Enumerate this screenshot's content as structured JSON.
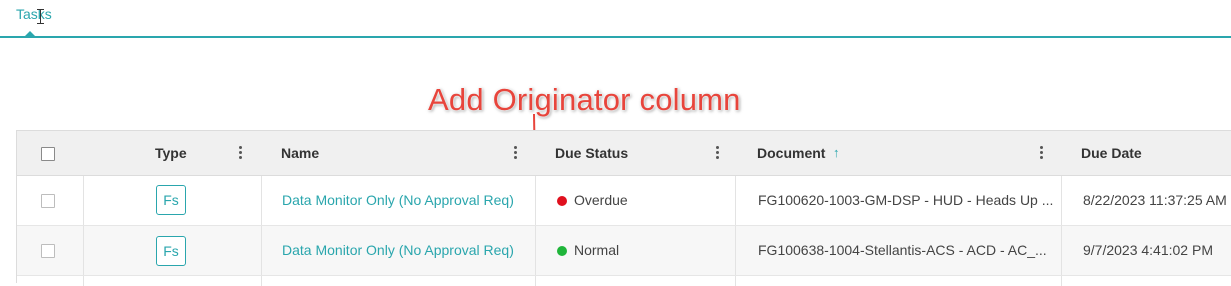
{
  "tabs": [
    {
      "label": "Tasks"
    }
  ],
  "annotation": {
    "text": "Add Originator column",
    "color": "#e8453c"
  },
  "grid": {
    "columns": [
      {
        "label": "Type"
      },
      {
        "label": "Name"
      },
      {
        "label": "Due Status"
      },
      {
        "label": "Document",
        "sort": "ascending"
      },
      {
        "label": "Due Date"
      }
    ],
    "rows": [
      {
        "type": "Fs",
        "name": "Data Monitor Only (No Approval Req)",
        "due_status": "Overdue",
        "status_color": "#e0101e",
        "document": "FG100620-1003-GM-DSP - HUD - Heads Up ...",
        "due_date": "8/22/2023 11:37:25 AM"
      },
      {
        "type": "Fs",
        "name": "Data Monitor Only (No Approval Req)",
        "due_status": "Normal",
        "status_color": "#1fb53a",
        "document": "FG100638-1004-Stellantis-ACS - ACD - AC_...",
        "due_date": "9/7/2023 4:41:02 PM"
      }
    ]
  },
  "colors": {
    "accent": "#2aa6ad"
  },
  "icons": {
    "sort": "arrow-up-icon",
    "column_menu": "kebab-icon",
    "cursor": "text-cursor-icon"
  }
}
